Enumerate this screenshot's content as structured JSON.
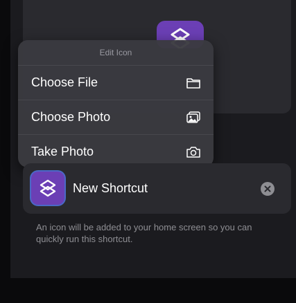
{
  "menu": {
    "title": "Edit Icon",
    "items": [
      {
        "label": "Choose File",
        "icon": "folder-icon"
      },
      {
        "label": "Choose Photo",
        "icon": "photo-icon"
      },
      {
        "label": "Take Photo",
        "icon": "camera-icon"
      }
    ]
  },
  "shortcut": {
    "name": "New Shortcut",
    "icon": "shortcuts-icon",
    "clear_icon": "clear-icon"
  },
  "footnote": "An icon will be added to your home screen so you can quickly run this shortcut.",
  "colors": {
    "accent_purple": "#6b3fb5",
    "focus_ring": "#4a69c7",
    "background": "#0a0a0c"
  }
}
